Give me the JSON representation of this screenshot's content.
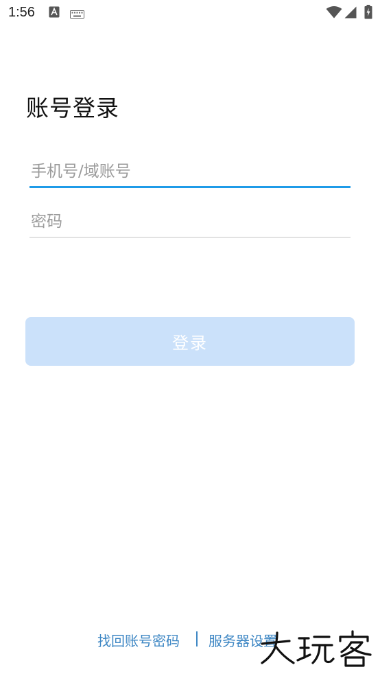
{
  "status_bar": {
    "time": "1:56",
    "icons": [
      "text-a-icon",
      "keyboard-icon",
      "wifi-icon",
      "signal-icon",
      "battery-charging-icon"
    ]
  },
  "login": {
    "title": "账号登录",
    "account_placeholder": "手机号/域账号",
    "account_value": "",
    "password_placeholder": "密码",
    "password_value": "",
    "login_button_label": "登录"
  },
  "footer": {
    "recover_link": "找回账号密码",
    "separator": "|",
    "server_link": "服务器设置"
  },
  "watermark": {
    "text": "大玩客"
  },
  "colors": {
    "accent": "#1f9be8",
    "button_disabled_bg": "#cbe1fa",
    "link": "#3e87c4"
  }
}
